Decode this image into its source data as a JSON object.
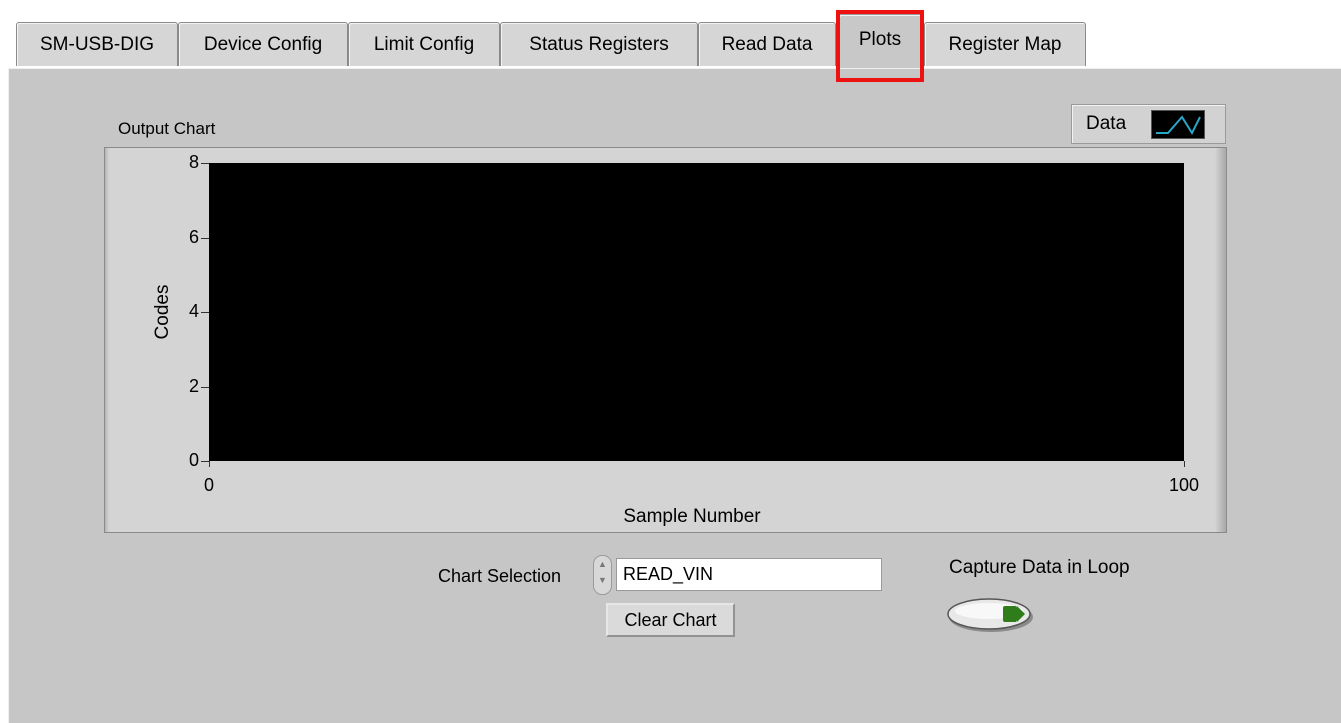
{
  "tabs": [
    {
      "label": "SM-USB-DIG"
    },
    {
      "label": "Device Config"
    },
    {
      "label": "Limit Config"
    },
    {
      "label": "Status Registers"
    },
    {
      "label": "Read Data"
    },
    {
      "label": "Plots",
      "active": true
    },
    {
      "label": "Register Map"
    }
  ],
  "colors": {
    "highlight": "#ee1111",
    "plot_background": "#000000",
    "series_line": "#2aa6c8",
    "panel": "#c6c6c6",
    "toggle_indicator": "#2e7d1a"
  },
  "chart": {
    "title": "Output Chart",
    "legend_label": "Data",
    "legend_icon": "line-plot-swatch-icon"
  },
  "chart_data": {
    "type": "line",
    "title": "Output Chart",
    "xlabel": "Sample Number",
    "ylabel": "Codes",
    "xlim": [
      0,
      100
    ],
    "ylim": [
      0,
      8
    ],
    "x_ticks": [
      "0",
      "100"
    ],
    "y_ticks": [
      "0",
      "2",
      "4",
      "6",
      "8"
    ],
    "series": [
      {
        "name": "Data",
        "x": [],
        "y": []
      }
    ],
    "legend": "top-right",
    "grid": false
  },
  "controls": {
    "chart_selection_label": "Chart Selection",
    "chart_selection_value": "READ_VIN",
    "clear_chart_label": "Clear Chart",
    "capture_label": "Capture Data in Loop",
    "capture_state": "off"
  }
}
